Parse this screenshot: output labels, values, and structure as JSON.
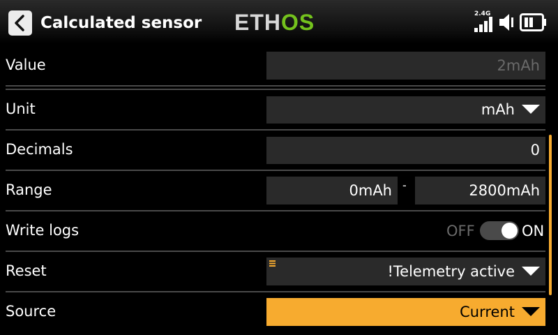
{
  "header": {
    "title": "Calculated sensor",
    "logo_left": "ETH",
    "logo_right": "OS",
    "rf_label": "2.4G"
  },
  "rows": {
    "value": {
      "label": "Value",
      "field": "2mAh"
    },
    "unit": {
      "label": "Unit",
      "field": "mAh"
    },
    "decimals": {
      "label": "Decimals",
      "field": "0"
    },
    "range": {
      "label": "Range",
      "min": "0mAh",
      "separator": "-",
      "max": "2800mAh"
    },
    "write_logs": {
      "label": "Write logs",
      "off_label": "OFF",
      "on_label": "ON",
      "state": "on"
    },
    "reset": {
      "label": "Reset",
      "field": "!Telemetry active"
    },
    "source": {
      "label": "Source",
      "field": "Current"
    }
  },
  "colors": {
    "accent": "#f7ab2f",
    "logo_green": "#74c21d",
    "field_bg": "#2a2a2a"
  },
  "icons": [
    "back-icon",
    "rf-signal-icon",
    "speaker-icon",
    "battery-icon",
    "dropdown-arrow-icon",
    "menu-icon"
  ]
}
